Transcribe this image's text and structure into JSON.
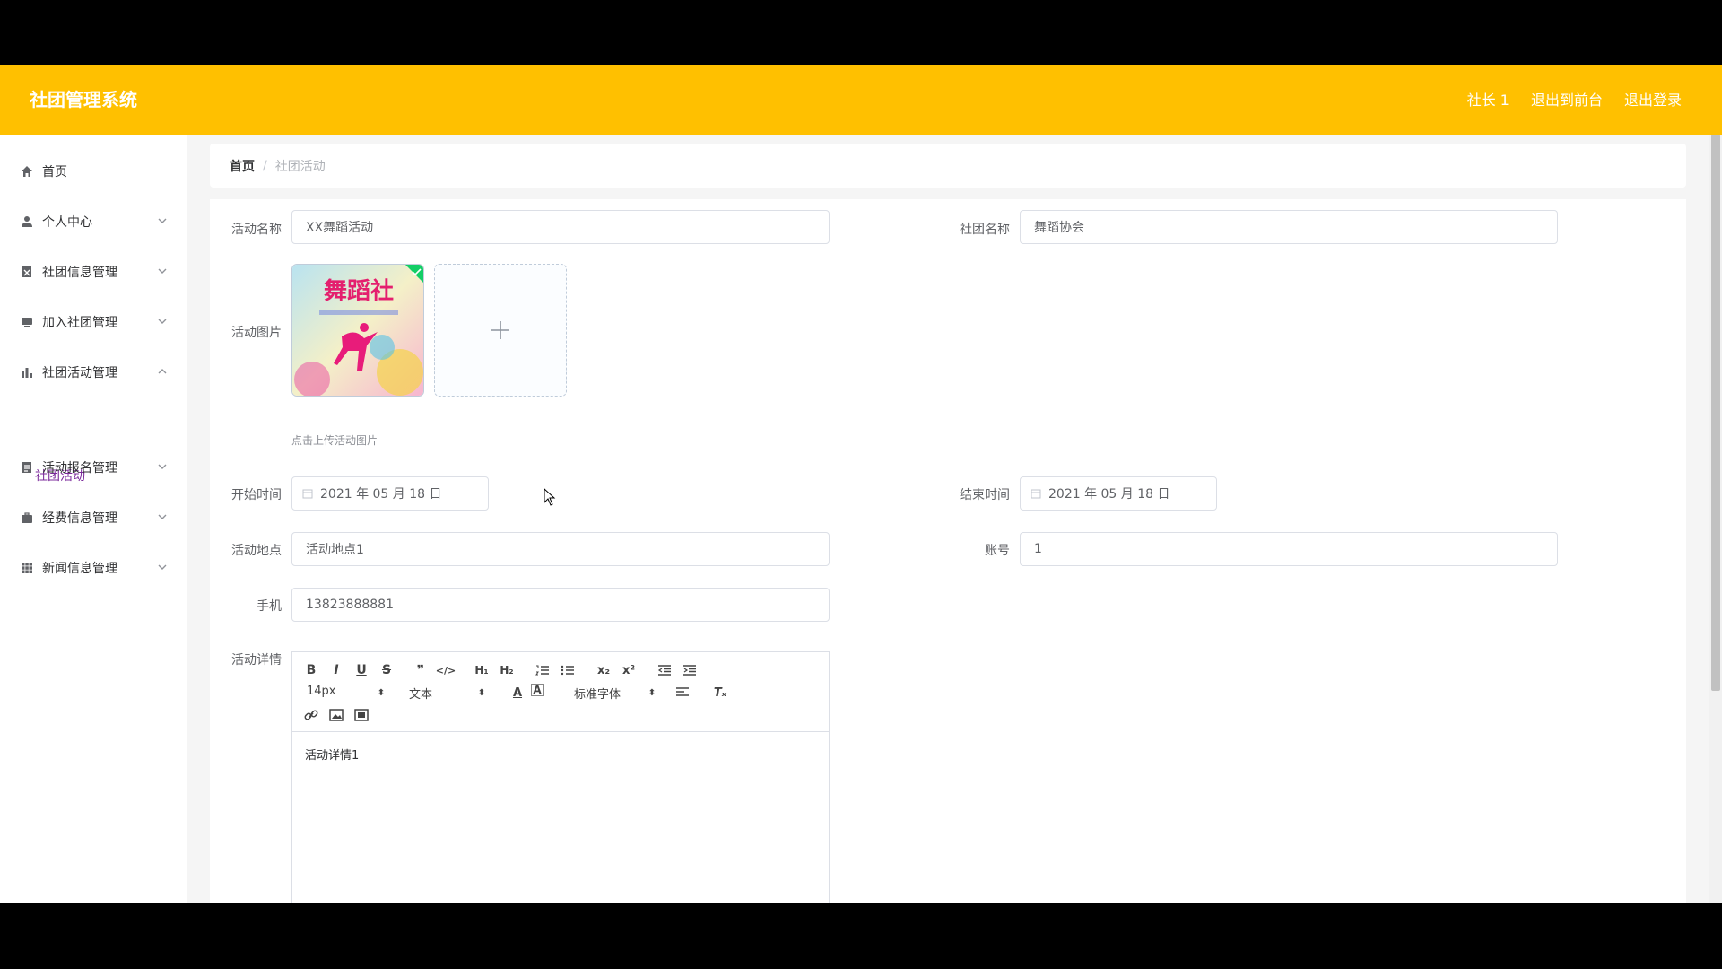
{
  "app": {
    "title": "社团管理系统"
  },
  "header_links": [
    "社长 1",
    "退出到前台",
    "退出登录"
  ],
  "sidebar": {
    "items": [
      {
        "label": "首页",
        "icon": "home-icon"
      },
      {
        "label": "个人中心",
        "icon": "user-icon"
      },
      {
        "label": "社团信息管理",
        "icon": "clipboard-icon"
      },
      {
        "label": "加入社团管理",
        "icon": "monitor-icon"
      },
      {
        "label": "社团活动管理",
        "icon": "bar-chart-icon"
      },
      {
        "label": "活动报名管理",
        "icon": "document-icon"
      },
      {
        "label": "经费信息管理",
        "icon": "briefcase-icon"
      },
      {
        "label": "新闻信息管理",
        "icon": "grid-icon"
      }
    ],
    "active_sub": "社团活动"
  },
  "breadcrumb": {
    "home": "首页",
    "separator": "/",
    "current": "社团活动"
  },
  "form": {
    "activity_name": {
      "label": "活动名称",
      "value": "XX舞蹈活动"
    },
    "club_name": {
      "label": "社团名称",
      "value": "舞蹈协会"
    },
    "activity_image": {
      "label": "活动图片",
      "hint": "点击上传活动图片"
    },
    "start_time": {
      "label": "开始时间",
      "value": "2021 年 05 月 18 日"
    },
    "end_time": {
      "label": "结束时间",
      "value": "2021 年 05 月 18 日"
    },
    "location": {
      "label": "活动地点",
      "value": "活动地点1"
    },
    "account": {
      "label": "账号",
      "value": "1"
    },
    "phone": {
      "label": "手机",
      "value": "13823888881"
    },
    "details": {
      "label": "活动详情",
      "content": "活动详情1",
      "font_size": "14px",
      "block_format": "文本",
      "font_family": "标准字体"
    }
  },
  "poster": {
    "text": "舞蹈社"
  }
}
